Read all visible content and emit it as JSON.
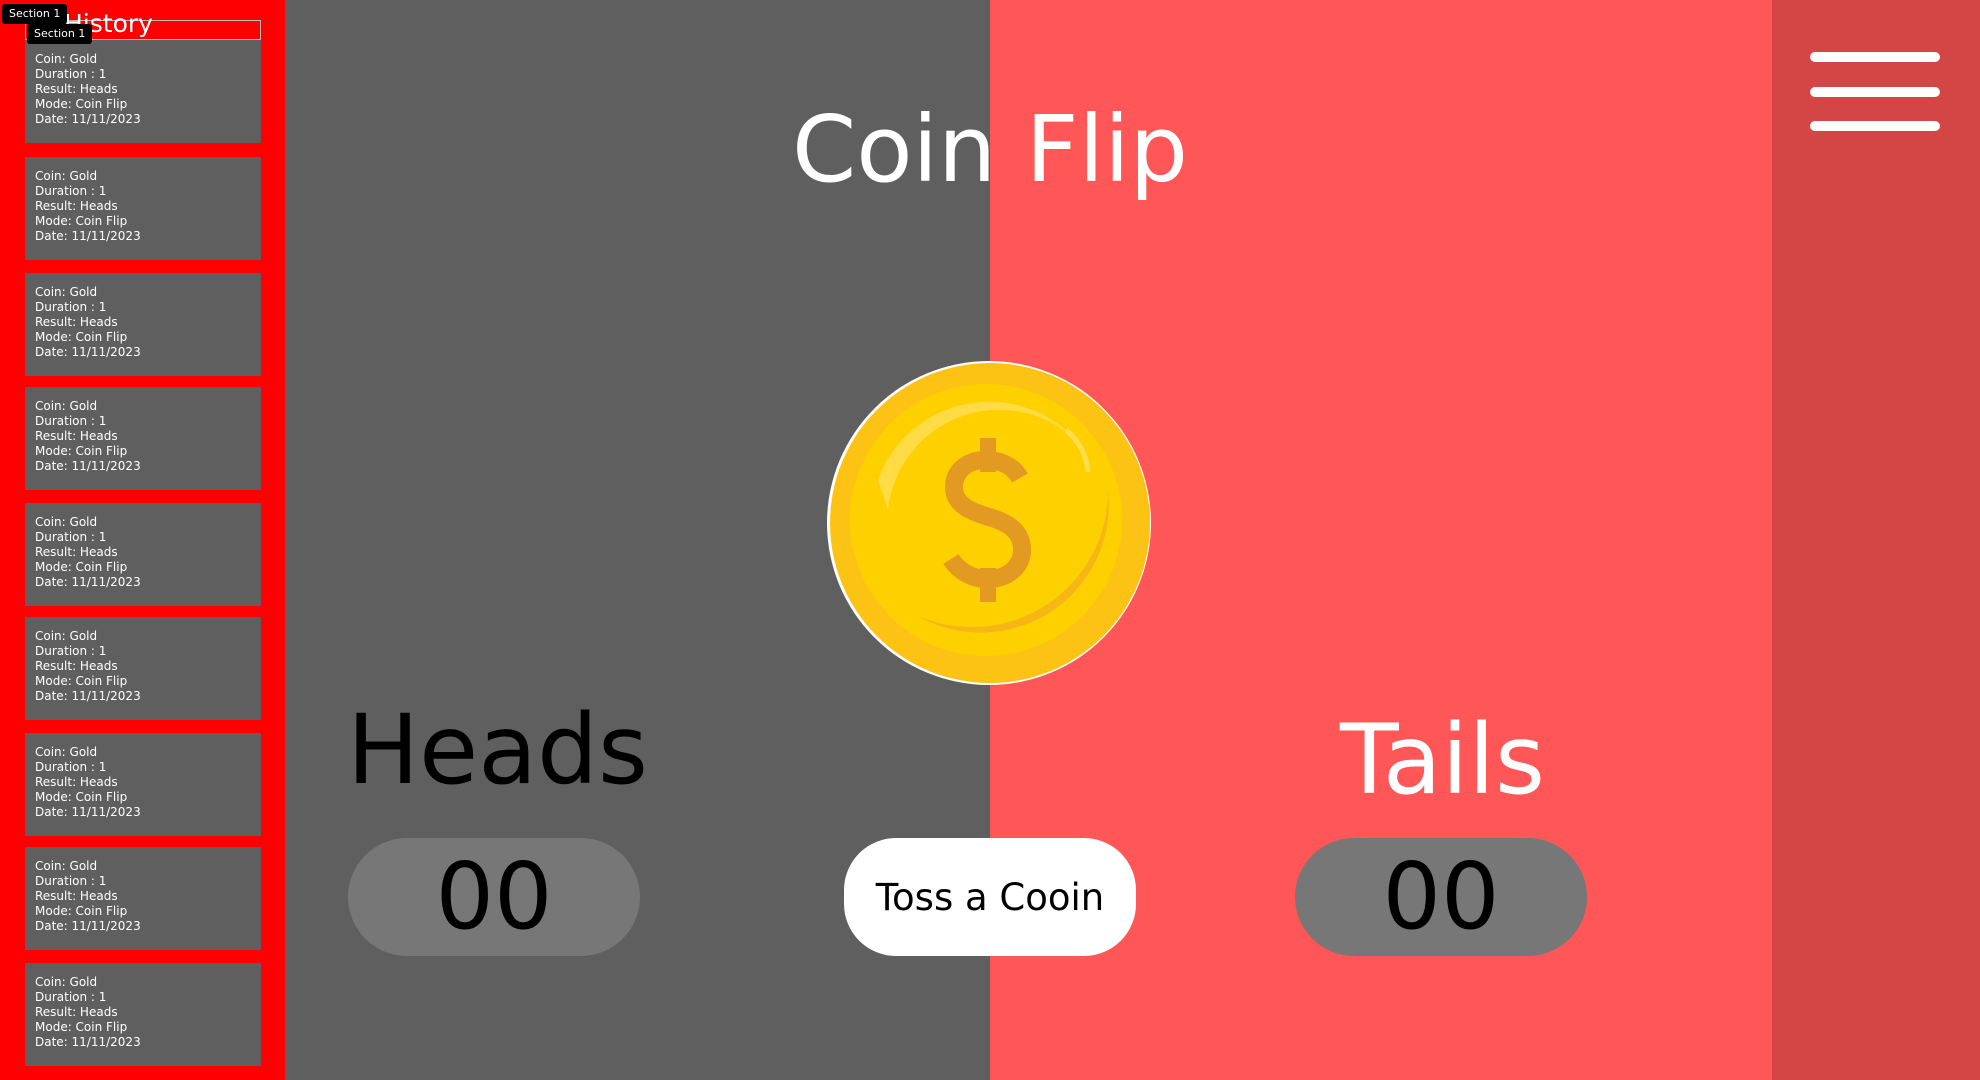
{
  "sidebar": {
    "title": "History",
    "tags": [
      "Section 1",
      "Section 1"
    ],
    "history": [
      {
        "coin": "Coin: Gold",
        "duration": "Duration : 1",
        "result": "Result: Heads",
        "mode": "Mode: Coin Flip",
        "date": "Date: 11/11/2023"
      },
      {
        "coin": "Coin: Gold",
        "duration": "Duration : 1",
        "result": "Result: Heads",
        "mode": "Mode: Coin Flip",
        "date": "Date: 11/11/2023"
      },
      {
        "coin": "Coin: Gold",
        "duration": "Duration : 1",
        "result": "Result: Heads",
        "mode": "Mode: Coin Flip",
        "date": "Date: 11/11/2023"
      },
      {
        "coin": "Coin: Gold",
        "duration": "Duration : 1",
        "result": "Result: Heads",
        "mode": "Mode: Coin Flip",
        "date": "Date: 11/11/2023"
      },
      {
        "coin": "Coin: Gold",
        "duration": "Duration : 1",
        "result": "Result: Heads",
        "mode": "Mode: Coin Flip",
        "date": "Date: 11/11/2023"
      },
      {
        "coin": "Coin: Gold",
        "duration": "Duration : 1",
        "result": "Result: Heads",
        "mode": "Mode: Coin Flip",
        "date": "Date: 11/11/2023"
      },
      {
        "coin": "Coin: Gold",
        "duration": "Duration : 1",
        "result": "Result: Heads",
        "mode": "Mode: Coin Flip",
        "date": "Date: 11/11/2023"
      },
      {
        "coin": "Coin: Gold",
        "duration": "Duration : 1",
        "result": "Result: Heads",
        "mode": "Mode: Coin Flip",
        "date": "Date: 11/11/2023"
      },
      {
        "coin": "Coin: Gold",
        "duration": "Duration : 1",
        "result": "Result: Heads",
        "mode": "Mode: Coin Flip",
        "date": "Date: 11/11/2023"
      }
    ]
  },
  "main": {
    "title": "Coin Flip",
    "coin_icon": "gold-dollar-coin-icon",
    "heads_label": "Heads",
    "tails_label": "Tails",
    "heads_score": "00",
    "tails_score": "00",
    "toss_button_label": "Toss a Cooin"
  },
  "menu": {
    "icon": "hamburger-menu-icon"
  },
  "colors": {
    "sidebar_bg": "#ff0000",
    "card_bg": "#5f5f5f",
    "heads_panel_bg": "#5f5f5f",
    "tails_panel_bg": "#ff5757",
    "menu_panel_bg": "#d44545",
    "score_pill_bg": "#777777",
    "coin_gold": "#ffd000",
    "coin_symbol": "#e39a23"
  }
}
